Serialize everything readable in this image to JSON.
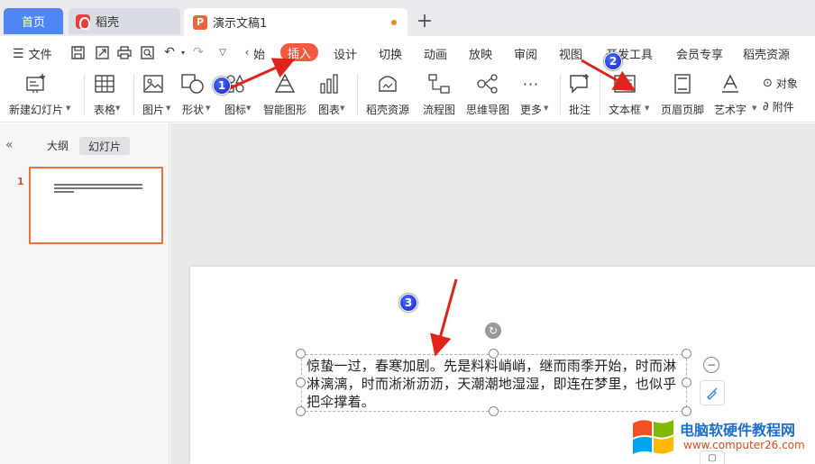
{
  "tabs": {
    "home": "首页",
    "wps": "稻壳",
    "doc": "演示文稿1",
    "new_tab": "+"
  },
  "menu": {
    "file": "文件",
    "items": [
      "始",
      "插入",
      "设计",
      "切换",
      "动画",
      "放映",
      "审阅",
      "视图",
      "开发工具",
      "会员专享",
      "稻壳资源"
    ]
  },
  "ribbon": {
    "new_slide": "新建幻灯片",
    "table": "表格",
    "picture": "图片",
    "shape": "形状",
    "icon": "图标",
    "smart_graphic": "智能图形",
    "chart": "图表",
    "docer_res": "稻壳资源",
    "flowchart": "流程图",
    "mindmap": "思维导图",
    "more": "更多",
    "comment": "批注",
    "textbox": "文本框",
    "header_footer": "页眉页脚",
    "wordart": "艺术字",
    "object": "对象",
    "attachment": "附件"
  },
  "panel": {
    "outline": "大纲",
    "slides": "幻灯片",
    "slide_number": "1"
  },
  "textbox": {
    "content": "惊蛰一过，春寒加剧。先是料料峭峭，继而雨季开始，时而淋淋漓漓，时而淅淅沥沥，天潮潮地湿湿，即连在梦里，也似乎把伞撑着。"
  },
  "annotations": {
    "step1": "1",
    "step2": "2",
    "step3": "3"
  },
  "watermark": {
    "title": "电脑软硬件教程网",
    "url": "www.computer26.com"
  },
  "colors": {
    "accent": "#f4583f",
    "home_tab": "#4e87f3",
    "slide_border": "#e4763e",
    "arrow": "#e0241b"
  }
}
